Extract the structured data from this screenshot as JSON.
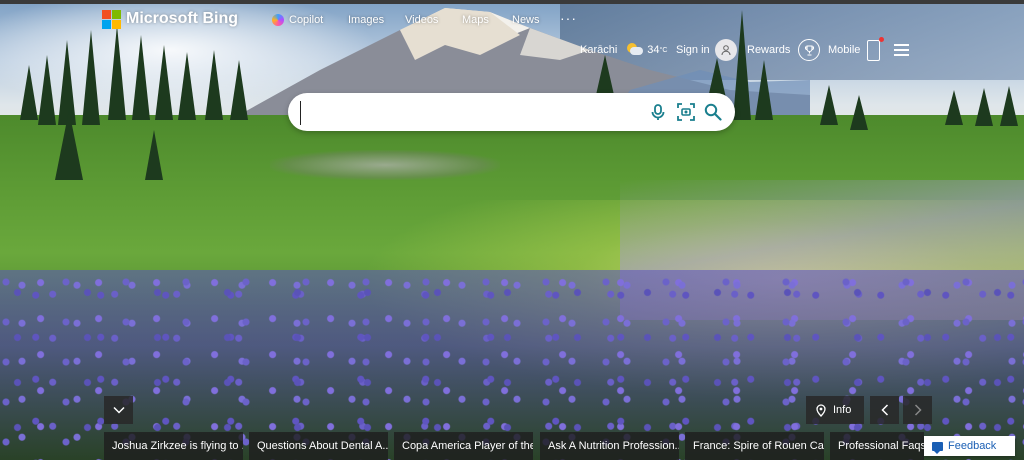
{
  "brand": {
    "name": "Microsoft Bing"
  },
  "nav": {
    "items": [
      {
        "label": "Copilot"
      },
      {
        "label": "Images"
      },
      {
        "label": "Videos"
      },
      {
        "label": "Maps"
      },
      {
        "label": "News"
      }
    ],
    "more_label": "···"
  },
  "header": {
    "location": "Karāchi",
    "temperature": "34",
    "temp_unit": "°C",
    "sign_in": "Sign in",
    "rewards": "Rewards",
    "mobile": "Mobile"
  },
  "search": {
    "placeholder": ""
  },
  "image_info": {
    "info_label": "Info"
  },
  "news": [
    {
      "title": "Joshua Zirkzee is flying to ..."
    },
    {
      "title": "Questions About Dental A..."
    },
    {
      "title": "Copa America Player of the..."
    },
    {
      "title": "Ask A Nutrition Profession..."
    },
    {
      "title": "France: Spire of Rouen Cat..."
    },
    {
      "title": "Professional Faqs: W"
    }
  ],
  "feedback": {
    "label": "Feedback"
  },
  "colors": {
    "ms_red": "#f25022",
    "ms_green": "#7fba00",
    "ms_blue": "#00a4ef",
    "ms_yellow": "#ffb900",
    "search_icon": "#1a7f8e",
    "feedback_text": "#1a5fb4"
  },
  "icons": {
    "mic": "microphone-icon",
    "visual_search": "camera-search-icon",
    "search": "magnifier-icon"
  }
}
